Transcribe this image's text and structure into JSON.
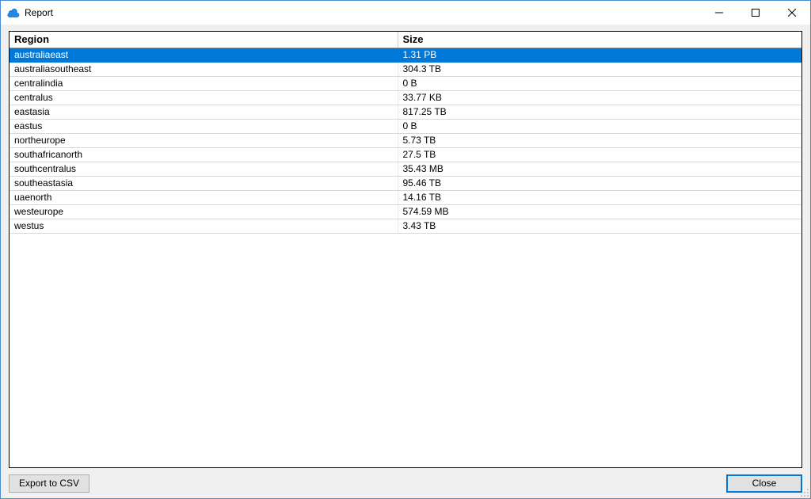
{
  "window": {
    "title": "Report"
  },
  "table": {
    "columns": [
      "Region",
      "Size"
    ],
    "selected_index": 0,
    "rows": [
      {
        "region": "australiaeast",
        "size": "1.31 PB"
      },
      {
        "region": "australiasoutheast",
        "size": "304.3 TB"
      },
      {
        "region": "centralindia",
        "size": "0 B"
      },
      {
        "region": "centralus",
        "size": "33.77 KB"
      },
      {
        "region": "eastasia",
        "size": "817.25 TB"
      },
      {
        "region": "eastus",
        "size": "0 B"
      },
      {
        "region": "northeurope",
        "size": "5.73 TB"
      },
      {
        "region": "southafricanorth",
        "size": "27.5 TB"
      },
      {
        "region": "southcentralus",
        "size": "35.43 MB"
      },
      {
        "region": "southeastasia",
        "size": "95.46 TB"
      },
      {
        "region": "uaenorth",
        "size": "14.16 TB"
      },
      {
        "region": "westeurope",
        "size": "574.59 MB"
      },
      {
        "region": "westus",
        "size": "3.43 TB"
      }
    ]
  },
  "buttons": {
    "export": "Export to CSV",
    "close": "Close"
  }
}
